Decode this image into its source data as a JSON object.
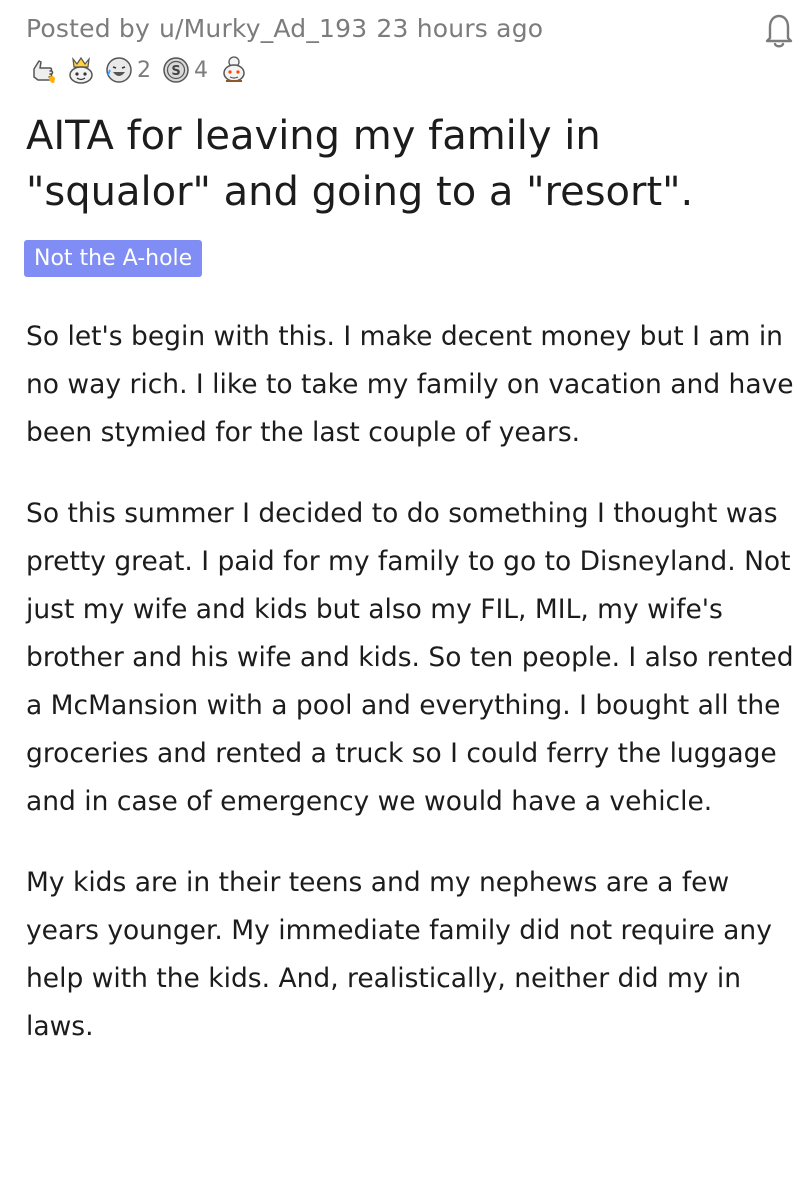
{
  "post": {
    "meta": {
      "posted_by_prefix": "Posted by",
      "username": "u/Murky_Ad_193",
      "time": "23 hours ago"
    },
    "awards": [
      {
        "icon": "thumbs-up-award-icon",
        "count": null
      },
      {
        "icon": "crowned-face-award-icon",
        "count": null
      },
      {
        "icon": "laughing-face-award-icon",
        "count": "2"
      },
      {
        "icon": "silver-coin-award-icon",
        "count": "4"
      },
      {
        "icon": "snoo-award-icon",
        "count": null
      }
    ],
    "title": "AITA for leaving my family in \"squalor\" and going to a \"resort\".",
    "flair": {
      "label": "Not the A-hole",
      "color": "#7f8df5"
    },
    "body": [
      "So let's begin with this. I make decent money but I am in no way rich. I like to take my family on vacation and have been stymied for the last couple of years.",
      "So this summer I decided to do something I thought was pretty great. I paid for my family to go to Disneyland. Not just my wife and kids but also my FIL, MIL, my wife's brother and his wife and kids. So ten people. I also rented a McMansion with a pool and everything. I bought all the groceries and rented a truck so I could ferry the luggage and in case of emergency we would have a vehicle.",
      "My kids are in their teens and my nephews are a few years younger. My immediate family did not require any help with the kids. And, realistically, neither did my in laws."
    ]
  },
  "colors": {
    "text": "#1c1c1c",
    "meta_text": "#7c7c7c",
    "flair_bg": "#7f8df5",
    "background": "#ffffff"
  }
}
